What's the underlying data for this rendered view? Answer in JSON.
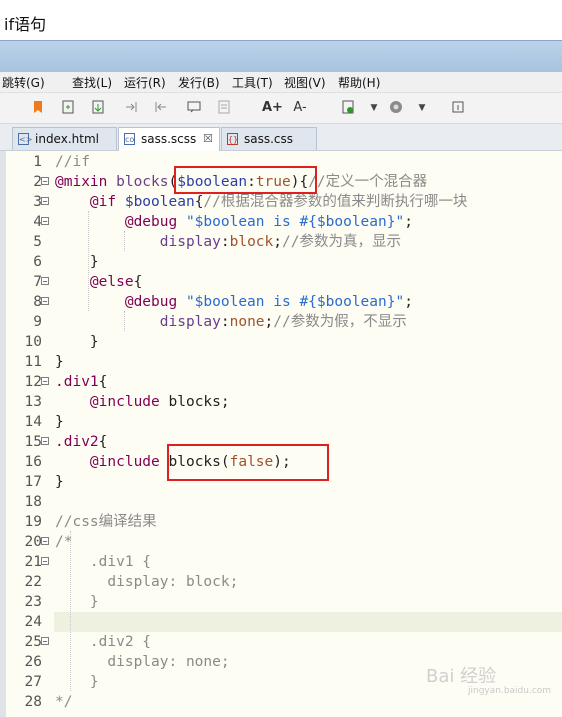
{
  "window": {
    "title": "if语句"
  },
  "menu": [
    "跳转(G)",
    "查找(L)",
    "运行(R)",
    "发行(B)",
    "工具(T)",
    "视图(V)",
    "帮助(H)"
  ],
  "toolbar_icons": [
    "bookmark-icon",
    "new-file-icon",
    "export-icon",
    "indent-icon",
    "outdent-icon",
    "comment-icon",
    "format-icon",
    "font-increase-icon",
    "font-decrease-icon",
    "run-icon",
    "dropdown-icon",
    "browser-icon",
    "dropdown-icon",
    "info-icon"
  ],
  "toolbar_text": {
    "font_up": "A+",
    "font_down": "A-"
  },
  "tabs": [
    {
      "label": "index.html",
      "active": false
    },
    {
      "label": "sass.scss",
      "active": true,
      "close": "☒"
    },
    {
      "label": "sass.css",
      "active": false
    }
  ],
  "editor": {
    "lines": [
      {
        "n": "1",
        "fold": false,
        "segs": [
          [
            "cm",
            "//if"
          ]
        ]
      },
      {
        "n": "2",
        "fold": true,
        "segs": [
          [
            "kw",
            "@mixin "
          ],
          [
            "mx",
            "blocks"
          ],
          [
            "pn",
            "("
          ],
          [
            "var",
            "$boolean"
          ],
          [
            "pn",
            ":"
          ],
          [
            "val",
            "true"
          ],
          [
            "pn",
            "){"
          ],
          [
            "cm",
            "//定义一个混合器"
          ]
        ]
      },
      {
        "n": "3",
        "fold": true,
        "segs": [
          [
            "pn",
            "    "
          ],
          [
            "kw",
            "@if "
          ],
          [
            "var",
            "$boolean"
          ],
          [
            "pn",
            "{"
          ],
          [
            "cm",
            "//根据混合器参数的值来判断执行哪一块"
          ]
        ]
      },
      {
        "n": "4",
        "fold": true,
        "segs": [
          [
            "pn",
            "        "
          ],
          [
            "kw",
            "@debug "
          ],
          [
            "str",
            "\"$boolean is #{$boolean}\""
          ],
          [
            "pn",
            ";"
          ]
        ]
      },
      {
        "n": "5",
        "fold": false,
        "segs": [
          [
            "pn",
            "            "
          ],
          [
            "mx",
            "display"
          ],
          [
            "pn",
            ":"
          ],
          [
            "val",
            "block"
          ],
          [
            "pn",
            ";"
          ],
          [
            "cm",
            "//参数为真，显示"
          ]
        ]
      },
      {
        "n": "6",
        "fold": false,
        "segs": [
          [
            "pn",
            "    }"
          ]
        ]
      },
      {
        "n": "7",
        "fold": true,
        "segs": [
          [
            "pn",
            "    "
          ],
          [
            "kw",
            "@else"
          ],
          [
            "pn",
            "{"
          ]
        ]
      },
      {
        "n": "8",
        "fold": true,
        "segs": [
          [
            "pn",
            "        "
          ],
          [
            "kw",
            "@debug "
          ],
          [
            "str",
            "\"$boolean is #{$boolean}\""
          ],
          [
            "pn",
            ";"
          ]
        ]
      },
      {
        "n": "9",
        "fold": false,
        "segs": [
          [
            "pn",
            "            "
          ],
          [
            "mx",
            "display"
          ],
          [
            "pn",
            ":"
          ],
          [
            "val",
            "none"
          ],
          [
            "pn",
            ";"
          ],
          [
            "cm",
            "//参数为假，不显示"
          ]
        ]
      },
      {
        "n": "10",
        "fold": false,
        "segs": [
          [
            "pn",
            "    }"
          ]
        ]
      },
      {
        "n": "11",
        "fold": false,
        "segs": [
          [
            "pn",
            "}"
          ]
        ]
      },
      {
        "n": "12",
        "fold": true,
        "segs": [
          [
            "kw",
            ".div1"
          ],
          [
            "pn",
            "{"
          ]
        ]
      },
      {
        "n": "13",
        "fold": false,
        "segs": [
          [
            "pn",
            "    "
          ],
          [
            "kw",
            "@include "
          ],
          [
            "pn",
            "blocks;"
          ]
        ]
      },
      {
        "n": "14",
        "fold": false,
        "segs": [
          [
            "pn",
            "}"
          ]
        ]
      },
      {
        "n": "15",
        "fold": true,
        "segs": [
          [
            "kw",
            ".div2"
          ],
          [
            "pn",
            "{"
          ]
        ]
      },
      {
        "n": "16",
        "fold": false,
        "segs": [
          [
            "pn",
            "    "
          ],
          [
            "kw",
            "@include "
          ],
          [
            "pn",
            "blocks("
          ],
          [
            "val",
            "false"
          ],
          [
            "pn",
            ");"
          ]
        ]
      },
      {
        "n": "17",
        "fold": false,
        "segs": [
          [
            "pn",
            "}"
          ]
        ]
      },
      {
        "n": "18",
        "fold": false,
        "segs": []
      },
      {
        "n": "19",
        "fold": false,
        "segs": [
          [
            "cm",
            "//css编译结果"
          ]
        ]
      },
      {
        "n": "20",
        "fold": true,
        "segs": [
          [
            "cm",
            "/*"
          ]
        ]
      },
      {
        "n": "21",
        "fold": true,
        "segs": [
          [
            "cm",
            "    .div1 {"
          ]
        ]
      },
      {
        "n": "22",
        "fold": false,
        "segs": [
          [
            "cm",
            "      display: block;"
          ]
        ]
      },
      {
        "n": "23",
        "fold": false,
        "segs": [
          [
            "cm",
            "    }"
          ]
        ]
      },
      {
        "n": "24",
        "fold": false,
        "segs": []
      },
      {
        "n": "25",
        "fold": true,
        "segs": [
          [
            "cm",
            "    .div2 {"
          ]
        ]
      },
      {
        "n": "26",
        "fold": false,
        "segs": [
          [
            "cm",
            "      display: none;"
          ]
        ]
      },
      {
        "n": "27",
        "fold": false,
        "segs": [
          [
            "cm",
            "    }"
          ]
        ]
      },
      {
        "n": "28",
        "fold": false,
        "segs": [
          [
            "cm",
            "*/"
          ]
        ]
      }
    ]
  },
  "watermark": {
    "main": "Bai 经验",
    "sub": "jingyan.baidu.com"
  },
  "colors": {
    "highlight_box": "#e02020",
    "editor_bg": "#fefdf3"
  }
}
